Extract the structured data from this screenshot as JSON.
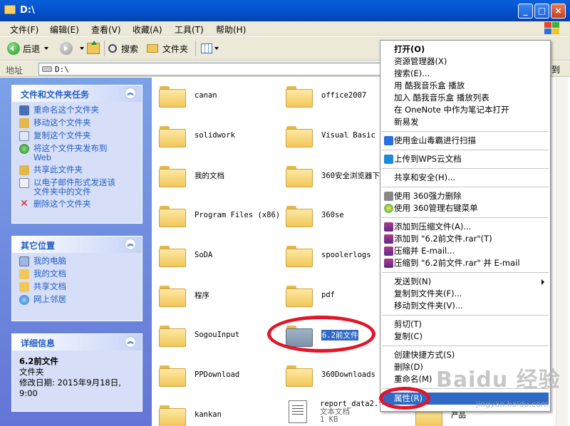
{
  "window": {
    "title": "D:\\",
    "minimize": "_",
    "maximize": "□",
    "close": "×"
  },
  "menubar": [
    "文件(F)",
    "编辑(E)",
    "查看(V)",
    "收藏(A)",
    "工具(T)",
    "帮助(H)"
  ],
  "toolbar": {
    "back": "后退",
    "search": "搜索",
    "folders": "文件夹"
  },
  "address": {
    "label": "地址",
    "path": "D:\\",
    "go": "转到"
  },
  "left_pane": {
    "tasks": {
      "title": "文件和文件夹任务",
      "items": [
        "重命名这个文件夹",
        "移动这个文件夹",
        "复制这个文件夹",
        "将这个文件夹发布到\nWeb",
        "共享此文件夹",
        "以电子邮件形式发送该\n文件夹中的文件",
        "删除这个文件夹"
      ]
    },
    "other_places": {
      "title": "其它位置",
      "items": [
        "我的电脑",
        "我的文档",
        "共享文档",
        "网上邻居"
      ]
    },
    "details": {
      "title": "详细信息",
      "name": "6.2前文件",
      "type": "文件夹",
      "modified": "修改日期: 2015年9月18日,\n9:00"
    }
  },
  "files": {
    "col1": [
      "canan",
      "solidwork",
      "我的文档",
      "Program Files (x86)",
      "SoDA",
      "程序",
      "SogouInput",
      "PPDownload",
      "kankan"
    ],
    "col2": [
      "office2007",
      "Visual Basic",
      "360安全浏览器下",
      "360se",
      "spoolerlogs",
      "pdf",
      "6.2前文件",
      "360Downloads"
    ],
    "doc": {
      "name": "report_data2.txt",
      "type": "文本文档",
      "size": "1 KB"
    },
    "partial": "产品"
  },
  "context_menu": {
    "group1": [
      "打开(O)",
      "资源管理器(X)",
      "搜索(E)...",
      "用 酷我音乐盒 播放",
      "加入 酷我音乐盒 播放列表",
      "在 OneNote 中作为笔记本打开",
      "新易发"
    ],
    "scan": "使用金山毒霸进行扫描",
    "wps": "上传到WPS云文档",
    "share": "共享和安全(H)...",
    "group360": [
      "使用 360强力删除",
      "使用 360管理右键菜单"
    ],
    "rar": [
      "添加到压缩文件(A)...",
      "添加到 \"6.2前文件.rar\"(T)",
      "压缩并 E-mail...",
      "压缩到 \"6.2前文件.rar\" 并 E-mail"
    ],
    "send": [
      "发送到(N)",
      "复制到文件夹(F)...",
      "移动到文件夹(V)..."
    ],
    "edit": [
      "剪切(T)",
      "复制(C)"
    ],
    "manage": [
      "创建快捷方式(S)",
      "删除(D)",
      "重命名(M)"
    ],
    "properties": "属性(R)"
  },
  "watermark": {
    "main": "Baidu 经验",
    "sub": "jingyan.baidu.com"
  },
  "colors": {
    "title_bar": "#0554d3",
    "left_pane": "#6f8fe0",
    "panel_link": "#215dc6",
    "selection": "#316ac5",
    "highlight_ring": "#e0162a"
  }
}
